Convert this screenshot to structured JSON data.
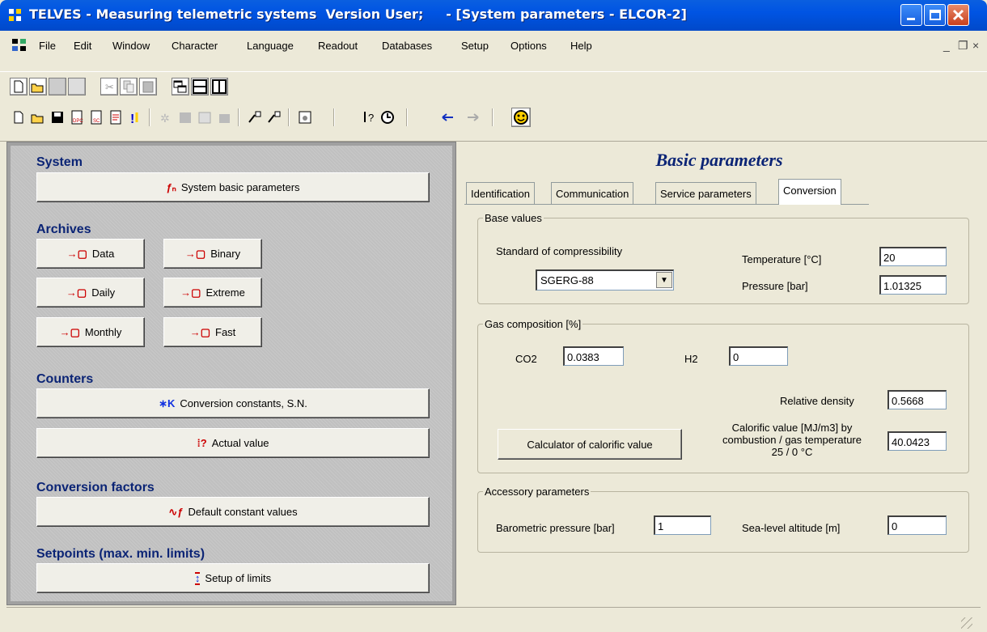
{
  "window": {
    "title": "TELVES - Measuring telemetric systems  Version User;     - [System parameters - ELCOR-2]"
  },
  "menu": [
    "File",
    "Edit",
    "Window",
    "Character",
    "Language",
    "Readout",
    "Databases",
    "Setup",
    "Options",
    "Help"
  ],
  "left": {
    "system": {
      "heading": "System",
      "btn": "System basic parameters"
    },
    "archives": {
      "heading": "Archives",
      "data": "Data",
      "binary": "Binary",
      "daily": "Daily",
      "extreme": "Extreme",
      "monthly": "Monthly",
      "fast": "Fast"
    },
    "counters": {
      "heading": "Counters",
      "conv": "Conversion constants, S.N.",
      "actual": "Actual value"
    },
    "convf": {
      "heading": "Conversion factors",
      "defaults": "Default constant values"
    },
    "setpoints": {
      "heading": "Setpoints (max. min. limits)",
      "limits": "Setup of limits"
    }
  },
  "right": {
    "title": "Basic parameters",
    "tabs": [
      "Identification",
      "Communication",
      "Service parameters",
      "Conversion"
    ],
    "base": {
      "legend": "Base values",
      "std_label": "Standard of compressibility",
      "std_value": "SGERG-88",
      "temp_label": "Temperature [°C]",
      "temp_value": "20",
      "press_label": "Pressure [bar]",
      "press_value": "1.01325"
    },
    "gas": {
      "legend": "Gas composition [%]",
      "co2_label": "CO2",
      "co2_value": "0.0383",
      "h2_label": "H2",
      "h2_value": "0",
      "rd_label": "Relative density",
      "rd_value": "0.5668",
      "calc_btn": "Calculator of calorific value",
      "cv_label1": "Calorific value [MJ/m3] by",
      "cv_label2": "combustion / gas temperature",
      "cv_label3": "25 / 0 °C",
      "cv_value": "40.0423"
    },
    "acc": {
      "legend": "Accessory parameters",
      "baro_label": "Barometric pressure [bar]",
      "baro_value": "1",
      "alt_label": "Sea-level altitude [m]",
      "alt_value": "0"
    }
  }
}
